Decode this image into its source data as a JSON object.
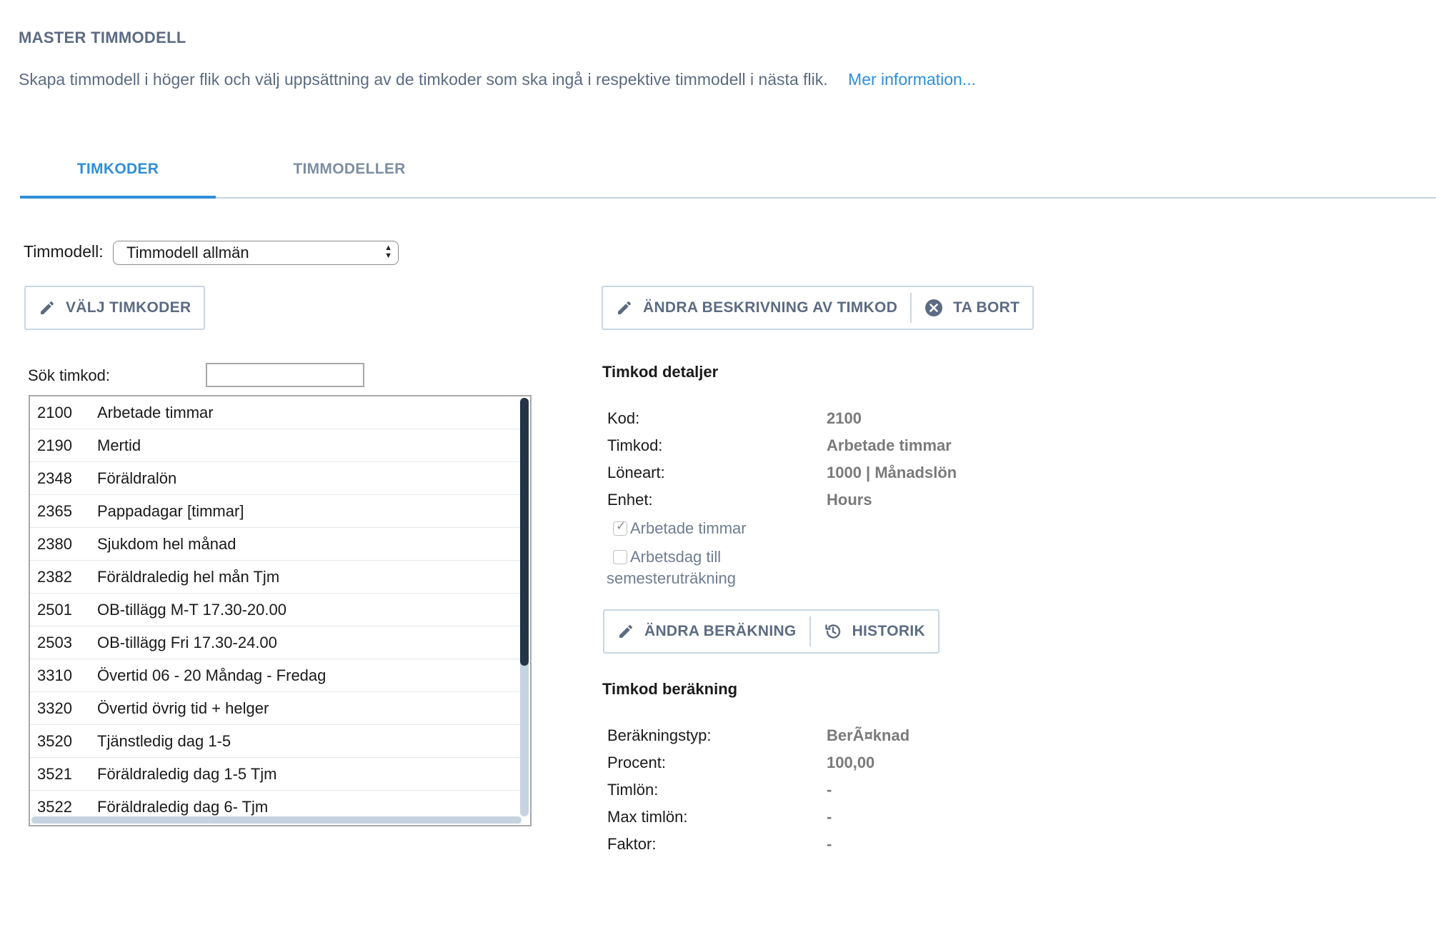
{
  "header": {
    "title": "MASTER TIMMODELL",
    "intro": "Skapa timmodell i höger flik och välj uppsättning av de timkoder som ska ingå i respektive timmodell i nästa flik.",
    "more_link": "Mer information..."
  },
  "tabs": [
    {
      "label": "TIMKODER",
      "active": true
    },
    {
      "label": "TIMMODELLER",
      "active": false
    }
  ],
  "model_selector": {
    "label": "Timmodell:",
    "value": "Timmodell allmän"
  },
  "left_toolbar": {
    "select_codes": "VÄLJ TIMKODER"
  },
  "search": {
    "label": "Sök timkod:",
    "value": ""
  },
  "codes": [
    {
      "code": "2100",
      "name": "Arbetade timmar"
    },
    {
      "code": "2190",
      "name": "Mertid"
    },
    {
      "code": "2348",
      "name": "Föräldralön"
    },
    {
      "code": "2365",
      "name": "Pappadagar [timmar]"
    },
    {
      "code": "2380",
      "name": "Sjukdom hel månad"
    },
    {
      "code": "2382",
      "name": "Föräldraledig hel mån Tjm"
    },
    {
      "code": "2501",
      "name": "OB-tillägg M-T 17.30-20.00"
    },
    {
      "code": "2503",
      "name": "OB-tillägg Fri 17.30-24.00"
    },
    {
      "code": "3310",
      "name": "Övertid 06 - 20 Måndag - Fredag"
    },
    {
      "code": "3320",
      "name": "Övertid övrig tid + helger"
    },
    {
      "code": "3520",
      "name": "Tjänstledig dag 1-5"
    },
    {
      "code": "3521",
      "name": "Föräldraledig dag 1-5 Tjm"
    },
    {
      "code": "3522",
      "name": "Föräldraledig dag 6- Tjm"
    }
  ],
  "right_toolbar": {
    "edit_description": "ÄNDRA BESKRIVNING AV TIMKOD",
    "delete": "TA BORT"
  },
  "details": {
    "title": "Timkod detaljer",
    "kod_label": "Kod:",
    "kod_value": "2100",
    "timkod_label": "Timkod:",
    "timkod_value": "Arbetade timmar",
    "loneart_label": "Löneart:",
    "loneart_value": "1000 | Månadslön",
    "enhet_label": "Enhet:",
    "enhet_value": "Hours",
    "check_worked_label": "Arbetade timmar",
    "check_worked_checked": true,
    "check_workday_label_1": "Arbetsdag till",
    "check_workday_label_2": "semesteruträkning",
    "check_workday_checked": false
  },
  "calc_toolbar": {
    "edit_calc": "ÄNDRA BERÄKNING",
    "history": "HISTORIK"
  },
  "calculation": {
    "title": "Timkod beräkning",
    "type_label": "Beräkningstyp:",
    "type_value": "BerÃ¤knad",
    "percent_label": "Procent:",
    "percent_value": "100,00",
    "hourly_label": "Timlön:",
    "hourly_value": "-",
    "max_label": "Max timlön:",
    "max_value": "-",
    "factor_label": "Faktor:",
    "factor_value": "-"
  },
  "colors": {
    "accent": "#2e8fd8",
    "muted": "#5c6b82",
    "scroll_thumb": "#243447"
  }
}
